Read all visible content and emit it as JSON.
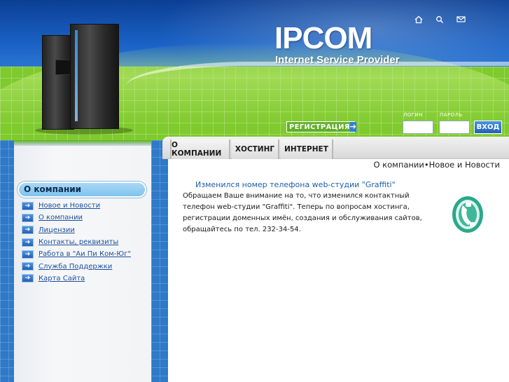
{
  "header": {
    "brand_title": "IPCOM",
    "brand_subtitle": "Internet Service Provider",
    "top_icons": [
      "home-icon",
      "search-icon",
      "mail-icon"
    ],
    "register_label": "РЕГИСТРАЦИЯ",
    "login_label": "ЛОГИН",
    "password_label": "ПАРОЛЬ",
    "login_value": "",
    "password_value": "",
    "enter_label": "ВХОД"
  },
  "tabs": [
    {
      "label": "О КОМПАНИИ"
    },
    {
      "label": "ХОСТИНГ"
    },
    {
      "label": "ИНТЕРНЕТ"
    }
  ],
  "breadcrumb": "О компании•Новое и Новости",
  "sidebar": {
    "section_title": "О компании",
    "items": [
      {
        "label": "Новое и Новости"
      },
      {
        "label": "О компании"
      },
      {
        "label": "Лицензии"
      },
      {
        "label": "Контакты, реквизиты"
      },
      {
        "label": "Работа в \"Аи Пи Ком-Юг\""
      },
      {
        "label": "Служба Поддержки"
      },
      {
        "label": "Карта Сайта"
      }
    ]
  },
  "news": {
    "title": "Изменился номер телефона web-студии \"Graffiti\"",
    "body": "Обращаем Ваше внимание на то, что изменился контактный телефон web-студии \"Graffiti\". Теперь по вопросам хостинга, регистрации доменных имён, создания и обслуживания сайтов, обращайтесь по тел. 232-34-54."
  },
  "colors": {
    "accent_blue": "#1e5ea8",
    "header_green": "#7fca2d",
    "sidebar_blue": "#2f79c9",
    "phone_green": "#3fb89a"
  }
}
